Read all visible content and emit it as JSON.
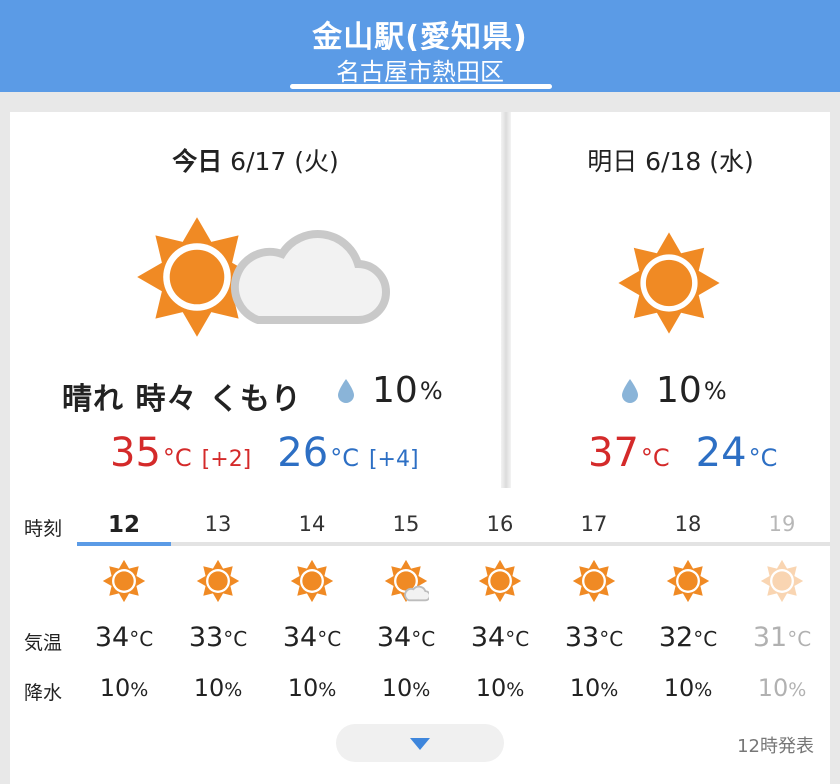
{
  "header": {
    "station": "金山駅(愛知県)",
    "area": "名古屋市熱田区"
  },
  "today": {
    "label": "今日",
    "date": "6/17",
    "weekday": "(火)",
    "weather": "晴れ 時々 くもり",
    "icon": "sun-cloud-icon",
    "rain": "10",
    "rain_unit": "%",
    "high": "35",
    "high_diff": "[+2]",
    "low": "26",
    "low_diff": "[+4]",
    "temp_unit": "°C"
  },
  "tomorrow": {
    "label": "明日",
    "date": "6/18",
    "weekday": "(水)",
    "icon": "sun-icon",
    "rain": "10",
    "rain_unit": "%",
    "high": "37",
    "low": "24",
    "temp_unit": "°C"
  },
  "hourly": {
    "time_label": "時刻",
    "temp_label": "気温",
    "rain_label": "降水",
    "temp_unit": "°C",
    "rain_unit": "%",
    "hours": [
      {
        "hour": "12",
        "icon": "sun-icon",
        "temp": "34",
        "rain": "10"
      },
      {
        "hour": "13",
        "icon": "sun-icon",
        "temp": "33",
        "rain": "10"
      },
      {
        "hour": "14",
        "icon": "sun-icon",
        "temp": "34",
        "rain": "10"
      },
      {
        "hour": "15",
        "icon": "sun-cloud-icon",
        "temp": "34",
        "rain": "10"
      },
      {
        "hour": "16",
        "icon": "sun-icon",
        "temp": "34",
        "rain": "10"
      },
      {
        "hour": "17",
        "icon": "sun-icon",
        "temp": "33",
        "rain": "10"
      },
      {
        "hour": "18",
        "icon": "sun-icon",
        "temp": "32",
        "rain": "10"
      },
      {
        "hour": "19",
        "icon": "sun-icon",
        "temp": "31",
        "rain": "10"
      }
    ]
  },
  "issued": "12時発表",
  "colors": {
    "header": "#5b9be6",
    "sun": "#f08a24",
    "high": "#d42a2a",
    "low": "#2d6fc4",
    "accent": "#3e86dc"
  }
}
